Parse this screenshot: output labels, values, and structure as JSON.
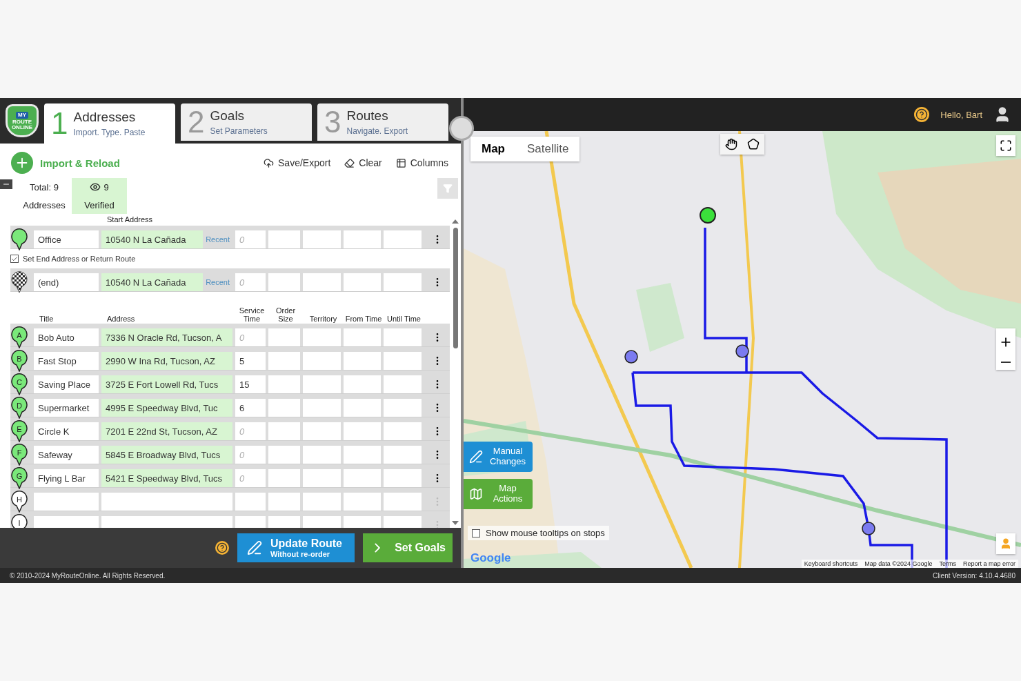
{
  "logo": {
    "lines": [
      "MY",
      "ROUTE",
      "ONLINE"
    ]
  },
  "steps": [
    {
      "number": "1",
      "title": "Addresses",
      "subtitle": "Import. Type. Paste",
      "selected": true
    },
    {
      "number": "2",
      "title": "Goals",
      "subtitle": "Set Parameters",
      "selected": false
    },
    {
      "number": "3",
      "title": "Routes",
      "subtitle": "Navigate. Export",
      "selected": false
    }
  ],
  "toolbar": {
    "import": "Import & Reload",
    "actions": [
      {
        "kind": "save",
        "label": "Save/Export"
      },
      {
        "kind": "clear",
        "label": "Clear"
      },
      {
        "kind": "columns",
        "label": "Columns"
      }
    ]
  },
  "summary": {
    "total": "Total: 9",
    "total_caption": "Addresses",
    "verified": "9",
    "verified_caption": "Verified"
  },
  "start": {
    "label": "Start Address",
    "title": "Office",
    "address": "10540 N La Cañada",
    "recent": "Recent",
    "service_placeholder": "0"
  },
  "end_option": {
    "label": "Set End Address or Return Route",
    "checked": true
  },
  "end": {
    "title": "(end)",
    "address": "10540 N La Cañada",
    "recent": "Recent",
    "service_placeholder": "0"
  },
  "columns": [
    "Title",
    "Address",
    "Service Time",
    "Order Size",
    "Territory",
    "From Time",
    "Until Time"
  ],
  "stops": [
    {
      "marker": "A",
      "title": "Bob Auto",
      "address": "7336 N Oracle Rd, Tucson, A",
      "service_placeholder": "0",
      "verified": true
    },
    {
      "marker": "B",
      "title": "Fast Stop",
      "address": "2990 W Ina Rd, Tucson, AZ",
      "service_time": "5",
      "verified": true
    },
    {
      "marker": "C",
      "title": "Saving Place",
      "address": "3725 E Fort Lowell Rd, Tucs",
      "service_time": "15",
      "verified": true
    },
    {
      "marker": "D",
      "title": "Supermarket",
      "address": "4995 E Speedway Blvd, Tuc",
      "service_time": "6",
      "verified": true
    },
    {
      "marker": "E",
      "title": "Circle K",
      "address": "7201 E 22nd St, Tucson, AZ",
      "service_placeholder": "0",
      "verified": true
    },
    {
      "marker": "F",
      "title": "Safeway",
      "address": "5845 E Broadway Blvd, Tucs",
      "service_placeholder": "0",
      "verified": true
    },
    {
      "marker": "G",
      "title": "Flying L Bar",
      "address": "5421 E Speedway Blvd, Tucs",
      "service_placeholder": "0",
      "verified": true
    },
    {
      "marker": "H",
      "verified": false
    },
    {
      "marker": "I",
      "verified": false
    }
  ],
  "actions": {
    "update_title": "Update Route",
    "update_subtitle": "Without re-order",
    "set_goals": "Set Goals"
  },
  "header": {
    "greeting": "Hello, Bart"
  },
  "map": {
    "view_tabs": [
      {
        "label": "Map",
        "selected": true
      },
      {
        "label": "Satellite",
        "selected": false
      }
    ],
    "manual_changes": "Manual Changes",
    "map_actions": "Map Actions",
    "tooltip_toggle": {
      "label": "Show mouse tooltips on stops",
      "checked": false
    },
    "logo": "Google",
    "attribution": [
      "Keyboard shortcuts",
      "Map data ©2024 Google",
      "Terms",
      "Report a map error"
    ]
  },
  "footer": {
    "copyright": "© 2010-2024 MyRouteOnline. All Rights Reserved.",
    "version": "Client Version: 4.10.4.4680"
  }
}
